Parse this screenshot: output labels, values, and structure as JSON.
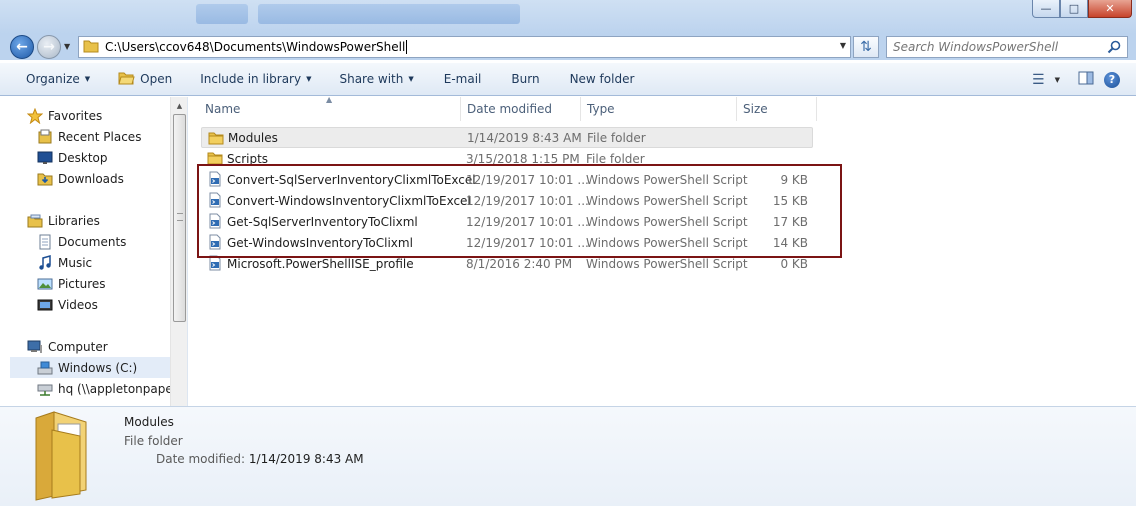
{
  "window": {
    "controls": [
      "minimize",
      "maximize",
      "close"
    ]
  },
  "address": {
    "path": "C:\\Users\\ccov648\\Documents\\WindowsPowerShell"
  },
  "search": {
    "placeholder": "Search WindowsPowerShell"
  },
  "toolbar": {
    "organize": "Organize",
    "open": "Open",
    "include_in_library": "Include in library",
    "share_with": "Share with",
    "email": "E-mail",
    "burn": "Burn",
    "new_folder": "New folder"
  },
  "sidebar": {
    "favorites": "Favorites",
    "recent_places": "Recent Places",
    "desktop": "Desktop",
    "downloads": "Downloads",
    "libraries": "Libraries",
    "documents": "Documents",
    "music": "Music",
    "pictures": "Pictures",
    "videos": "Videos",
    "computer": "Computer",
    "windows_c": "Windows (C:)",
    "hq": "hq (\\\\appletonpapers"
  },
  "columns": {
    "name": "Name",
    "date": "Date modified",
    "type": "Type",
    "size": "Size"
  },
  "files": [
    {
      "name": "Modules",
      "date": "1/14/2019 8:43 AM",
      "type": "File folder",
      "size": "",
      "kind": "folder"
    },
    {
      "name": "Scripts",
      "date": "3/15/2018 1:15 PM",
      "type": "File folder",
      "size": "",
      "kind": "folder"
    },
    {
      "name": "Convert-SqlServerInventoryClixmlToExcel",
      "date": "12/19/2017 10:01 ...",
      "type": "Windows PowerShell Script",
      "size": "9 KB",
      "kind": "script"
    },
    {
      "name": "Convert-WindowsInventoryClixmlToExcel",
      "date": "12/19/2017 10:01 ...",
      "type": "Windows PowerShell Script",
      "size": "15 KB",
      "kind": "script"
    },
    {
      "name": "Get-SqlServerInventoryToClixml",
      "date": "12/19/2017 10:01 ...",
      "type": "Windows PowerShell Script",
      "size": "17 KB",
      "kind": "script"
    },
    {
      "name": "Get-WindowsInventoryToClixml",
      "date": "12/19/2017 10:01 ...",
      "type": "Windows PowerShell Script",
      "size": "14 KB",
      "kind": "script"
    },
    {
      "name": "Microsoft.PowerShellISE_profile",
      "date": "8/1/2016 2:40 PM",
      "type": "Windows PowerShell Script",
      "size": "0 KB",
      "kind": "script"
    }
  ],
  "details": {
    "name": "Modules",
    "type": "File folder",
    "modified_label": "Date modified:",
    "modified_value": "1/14/2019 8:43 AM"
  },
  "colors": {
    "highlight_box": "#7b1414",
    "folder_yellow": "#e8c14a"
  }
}
